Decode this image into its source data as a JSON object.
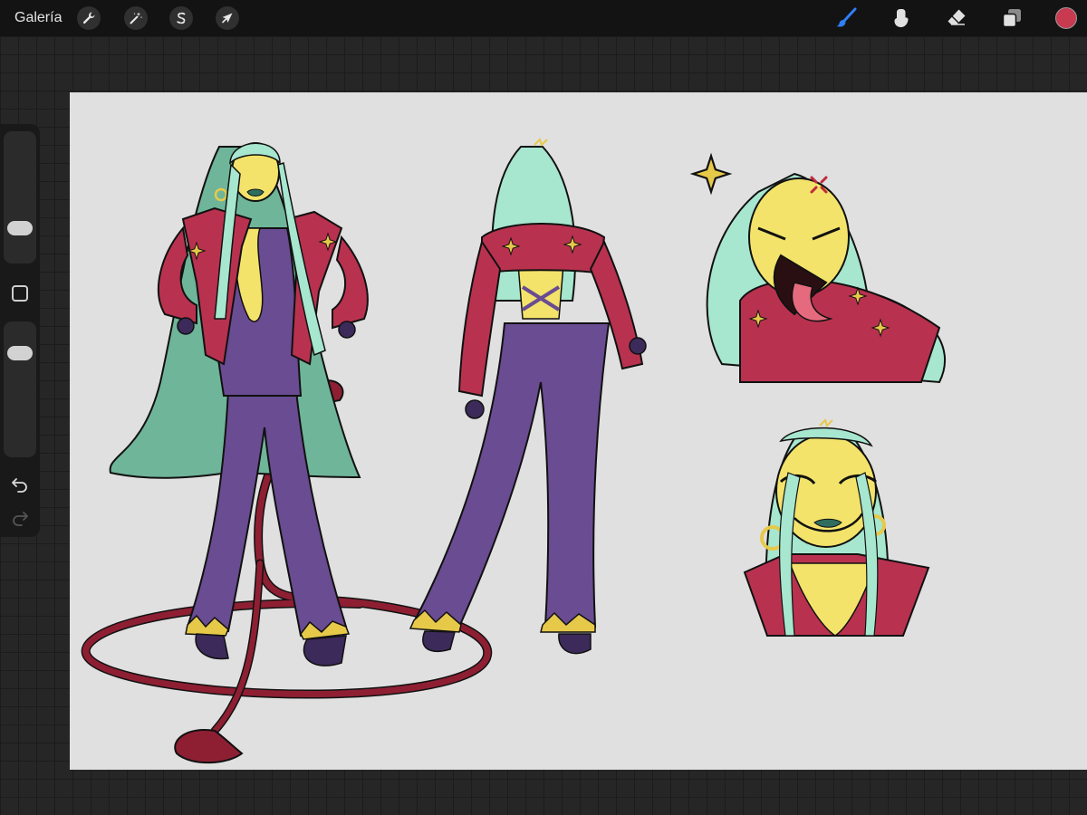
{
  "toolbar": {
    "gallery_label": "Galería",
    "left_tools": [
      {
        "name": "actions",
        "icon": "wrench-icon"
      },
      {
        "name": "adjustments",
        "icon": "magic-wand-icon"
      },
      {
        "name": "selection",
        "icon": "selection-s-icon"
      },
      {
        "name": "transform",
        "icon": "arrow-cursor-icon"
      }
    ],
    "right_tools": [
      {
        "name": "brush",
        "icon": "brush-icon",
        "active": true
      },
      {
        "name": "smudge",
        "icon": "smudge-finger-icon",
        "active": false
      },
      {
        "name": "eraser",
        "icon": "eraser-icon",
        "active": false
      },
      {
        "name": "layers",
        "icon": "layers-icon",
        "active": false
      }
    ],
    "active_tool_color": "#2f7ff6",
    "current_color": "#c73a4f"
  },
  "sidebar": {
    "brush_size_level": 0.22,
    "opacity_level": 0.82,
    "icons": [
      "modify-square-icon",
      "undo-icon",
      "redo-icon"
    ]
  },
  "canvas": {
    "background_color": "#e0e0e0",
    "artwork": "character-sheet",
    "palette": {
      "hair": "#a7e6cf",
      "hair_shadow": "#6fb59a",
      "skin": "#f3e36a",
      "jacket": "#b8324f",
      "jumpsuit": "#6a4c92",
      "gold": "#e7c94a",
      "tail": "#8e1f33",
      "lips": "#2f6e5f",
      "line": "#111111"
    }
  }
}
